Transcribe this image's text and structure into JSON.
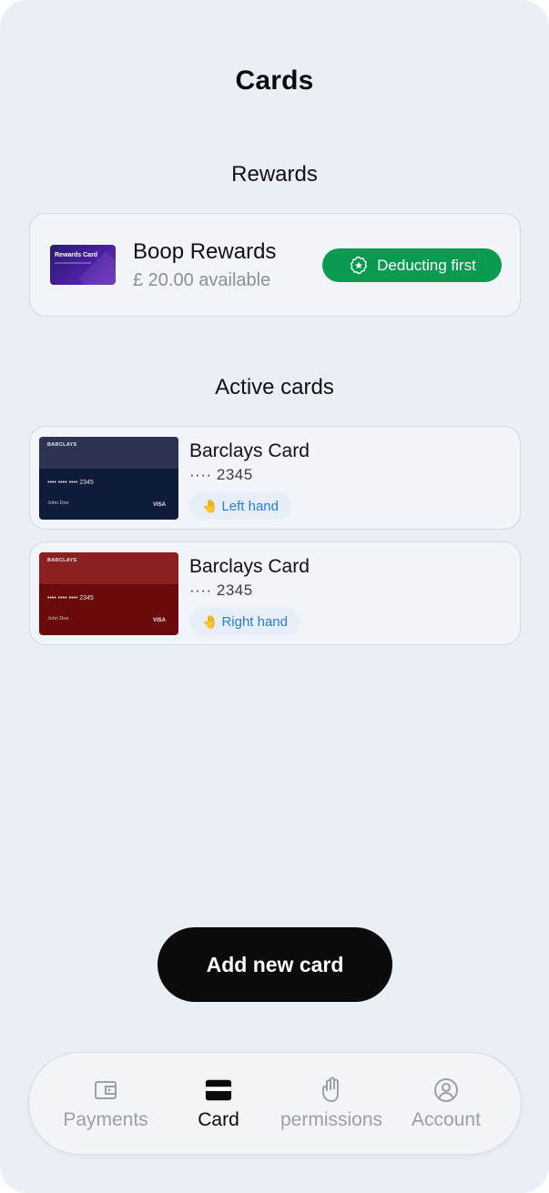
{
  "header": {
    "title": "Cards"
  },
  "rewards": {
    "heading": "Rewards",
    "thumb_title": "Rewards Card",
    "name": "Boop Rewards",
    "available": "£ 20.00 available",
    "badge": "Deducting first",
    "badge_color": "#0a9b51"
  },
  "active_cards": {
    "heading": "Active cards",
    "items": [
      {
        "brand": "BARCLAYS",
        "thumb_number": "•••• •••• •••• 2345",
        "holder": "John Doe",
        "network": "VISA",
        "name": "Barclays Card",
        "digits": "···· 2345",
        "hand_label": "Left hand",
        "hand_icon": "waving-hand-icon",
        "color": "#0f1b3a"
      },
      {
        "brand": "BARCLAYS",
        "thumb_number": "•••• •••• •••• 2345",
        "holder": "John Doe",
        "network": "VISA",
        "name": "Barclays Card",
        "digits": "···· 2345",
        "hand_label": "Right hand",
        "hand_icon": "waving-hand-icon",
        "color": "#6b0a0a"
      }
    ]
  },
  "actions": {
    "add_card_label": "Add new card"
  },
  "nav": {
    "items": [
      {
        "label": "Payments",
        "icon": "wallet-icon",
        "active": false
      },
      {
        "label": "Card",
        "icon": "credit-card-icon",
        "active": true
      },
      {
        "label": "permissions",
        "icon": "hand-icon",
        "active": false
      },
      {
        "label": "Account",
        "icon": "account-icon",
        "active": false
      }
    ]
  },
  "colors": {
    "background": "#eaeef5",
    "accent_blue": "#2a7ae2",
    "primary_button": "#0b0b0b"
  }
}
